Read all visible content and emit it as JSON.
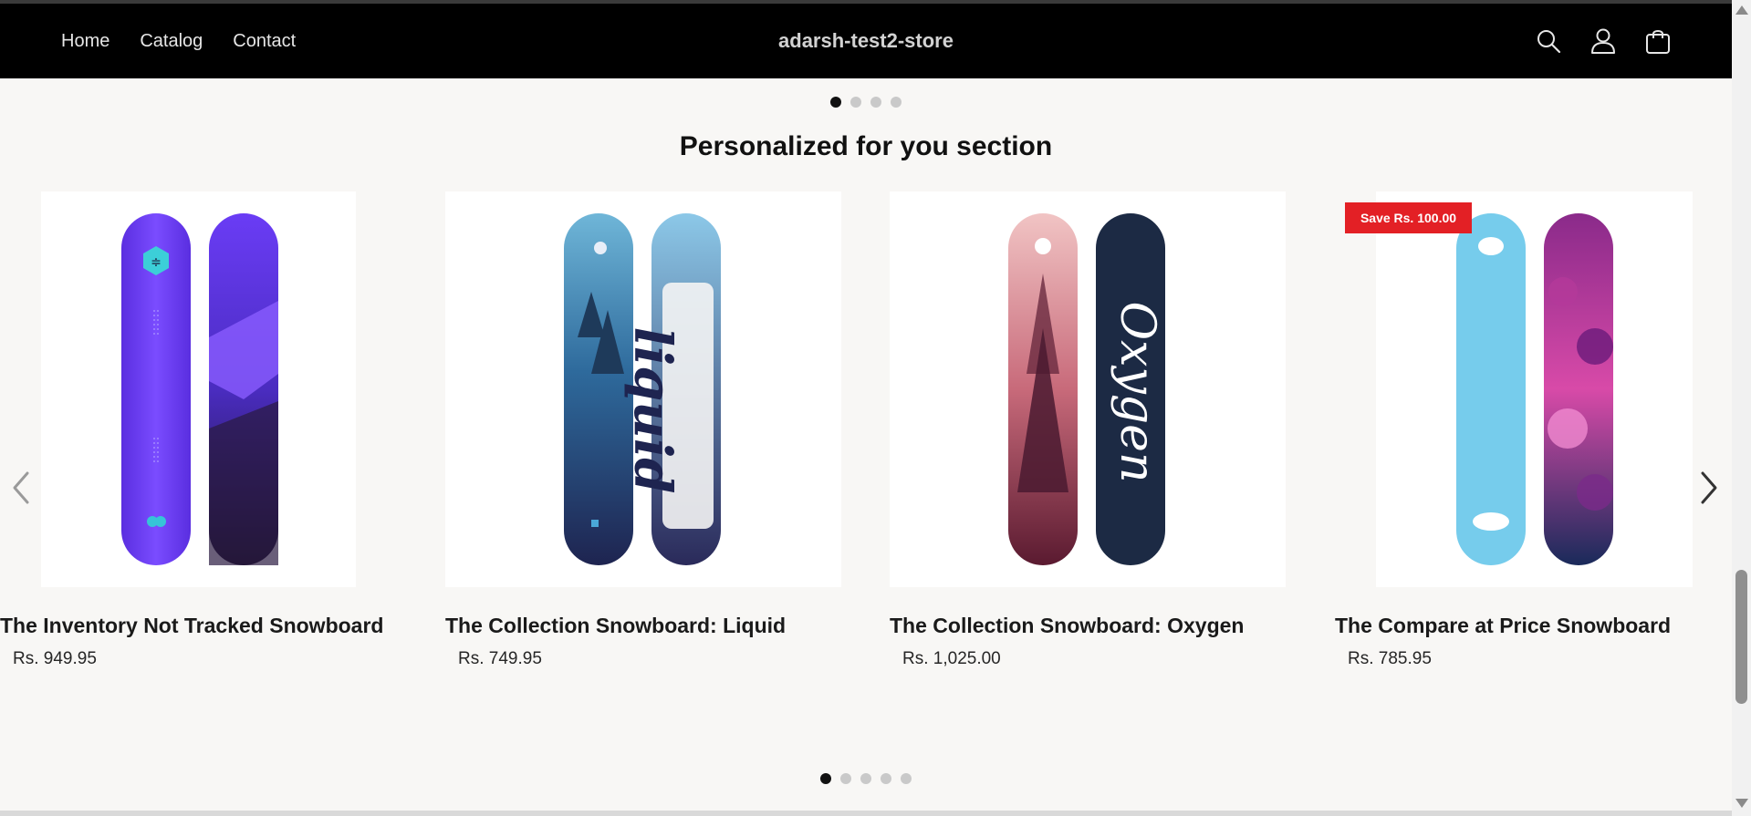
{
  "header": {
    "store_name": "adarsh-test2-store",
    "nav": [
      "Home",
      "Catalog",
      "Contact"
    ],
    "icons": [
      "search-icon",
      "account-icon",
      "cart-icon"
    ]
  },
  "section": {
    "title": "Personalized for you section"
  },
  "top_pager": {
    "count": 4,
    "active": 0
  },
  "bottom_pager": {
    "count": 5,
    "active": 0
  },
  "products": [
    {
      "name": "The Inventory Not Tracked Snowboard",
      "price": "Rs. 949.95",
      "badge": ""
    },
    {
      "name": "The Collection Snowboard: Liquid",
      "price": "Rs. 749.95",
      "badge": ""
    },
    {
      "name": "The Collection Snowboard: Oxygen",
      "price": "Rs. 1,025.00",
      "badge": ""
    },
    {
      "name": "The Compare at Price Snowboard",
      "price": "Rs. 785.95",
      "badge": "Save Rs. 100.00"
    }
  ],
  "colors": {
    "header_bg": "#000000",
    "page_bg": "#f8f7f5",
    "badge_bg": "#e32025"
  }
}
